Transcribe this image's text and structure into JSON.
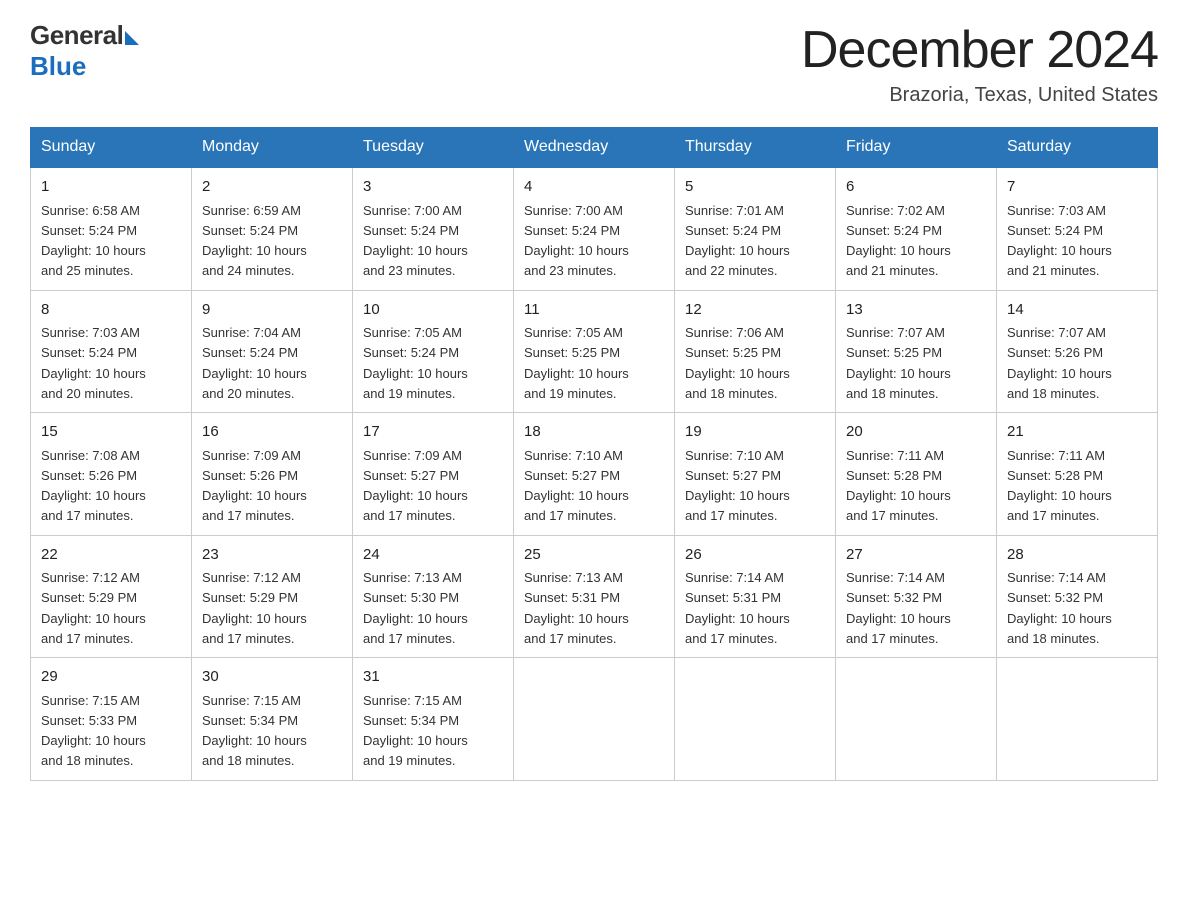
{
  "logo": {
    "general": "General",
    "blue": "Blue"
  },
  "header": {
    "title": "December 2024",
    "subtitle": "Brazoria, Texas, United States"
  },
  "days_of_week": [
    "Sunday",
    "Monday",
    "Tuesday",
    "Wednesday",
    "Thursday",
    "Friday",
    "Saturday"
  ],
  "weeks": [
    [
      {
        "day": "1",
        "sunrise": "6:58 AM",
        "sunset": "5:24 PM",
        "daylight": "10 hours and 25 minutes."
      },
      {
        "day": "2",
        "sunrise": "6:59 AM",
        "sunset": "5:24 PM",
        "daylight": "10 hours and 24 minutes."
      },
      {
        "day": "3",
        "sunrise": "7:00 AM",
        "sunset": "5:24 PM",
        "daylight": "10 hours and 23 minutes."
      },
      {
        "day": "4",
        "sunrise": "7:00 AM",
        "sunset": "5:24 PM",
        "daylight": "10 hours and 23 minutes."
      },
      {
        "day": "5",
        "sunrise": "7:01 AM",
        "sunset": "5:24 PM",
        "daylight": "10 hours and 22 minutes."
      },
      {
        "day": "6",
        "sunrise": "7:02 AM",
        "sunset": "5:24 PM",
        "daylight": "10 hours and 21 minutes."
      },
      {
        "day": "7",
        "sunrise": "7:03 AM",
        "sunset": "5:24 PM",
        "daylight": "10 hours and 21 minutes."
      }
    ],
    [
      {
        "day": "8",
        "sunrise": "7:03 AM",
        "sunset": "5:24 PM",
        "daylight": "10 hours and 20 minutes."
      },
      {
        "day": "9",
        "sunrise": "7:04 AM",
        "sunset": "5:24 PM",
        "daylight": "10 hours and 20 minutes."
      },
      {
        "day": "10",
        "sunrise": "7:05 AM",
        "sunset": "5:24 PM",
        "daylight": "10 hours and 19 minutes."
      },
      {
        "day": "11",
        "sunrise": "7:05 AM",
        "sunset": "5:25 PM",
        "daylight": "10 hours and 19 minutes."
      },
      {
        "day": "12",
        "sunrise": "7:06 AM",
        "sunset": "5:25 PM",
        "daylight": "10 hours and 18 minutes."
      },
      {
        "day": "13",
        "sunrise": "7:07 AM",
        "sunset": "5:25 PM",
        "daylight": "10 hours and 18 minutes."
      },
      {
        "day": "14",
        "sunrise": "7:07 AM",
        "sunset": "5:26 PM",
        "daylight": "10 hours and 18 minutes."
      }
    ],
    [
      {
        "day": "15",
        "sunrise": "7:08 AM",
        "sunset": "5:26 PM",
        "daylight": "10 hours and 17 minutes."
      },
      {
        "day": "16",
        "sunrise": "7:09 AM",
        "sunset": "5:26 PM",
        "daylight": "10 hours and 17 minutes."
      },
      {
        "day": "17",
        "sunrise": "7:09 AM",
        "sunset": "5:27 PM",
        "daylight": "10 hours and 17 minutes."
      },
      {
        "day": "18",
        "sunrise": "7:10 AM",
        "sunset": "5:27 PM",
        "daylight": "10 hours and 17 minutes."
      },
      {
        "day": "19",
        "sunrise": "7:10 AM",
        "sunset": "5:27 PM",
        "daylight": "10 hours and 17 minutes."
      },
      {
        "day": "20",
        "sunrise": "7:11 AM",
        "sunset": "5:28 PM",
        "daylight": "10 hours and 17 minutes."
      },
      {
        "day": "21",
        "sunrise": "7:11 AM",
        "sunset": "5:28 PM",
        "daylight": "10 hours and 17 minutes."
      }
    ],
    [
      {
        "day": "22",
        "sunrise": "7:12 AM",
        "sunset": "5:29 PM",
        "daylight": "10 hours and 17 minutes."
      },
      {
        "day": "23",
        "sunrise": "7:12 AM",
        "sunset": "5:29 PM",
        "daylight": "10 hours and 17 minutes."
      },
      {
        "day": "24",
        "sunrise": "7:13 AM",
        "sunset": "5:30 PM",
        "daylight": "10 hours and 17 minutes."
      },
      {
        "day": "25",
        "sunrise": "7:13 AM",
        "sunset": "5:31 PM",
        "daylight": "10 hours and 17 minutes."
      },
      {
        "day": "26",
        "sunrise": "7:14 AM",
        "sunset": "5:31 PM",
        "daylight": "10 hours and 17 minutes."
      },
      {
        "day": "27",
        "sunrise": "7:14 AM",
        "sunset": "5:32 PM",
        "daylight": "10 hours and 17 minutes."
      },
      {
        "day": "28",
        "sunrise": "7:14 AM",
        "sunset": "5:32 PM",
        "daylight": "10 hours and 18 minutes."
      }
    ],
    [
      {
        "day": "29",
        "sunrise": "7:15 AM",
        "sunset": "5:33 PM",
        "daylight": "10 hours and 18 minutes."
      },
      {
        "day": "30",
        "sunrise": "7:15 AM",
        "sunset": "5:34 PM",
        "daylight": "10 hours and 18 minutes."
      },
      {
        "day": "31",
        "sunrise": "7:15 AM",
        "sunset": "5:34 PM",
        "daylight": "10 hours and 19 minutes."
      },
      null,
      null,
      null,
      null
    ]
  ],
  "labels": {
    "sunrise": "Sunrise:",
    "sunset": "Sunset:",
    "daylight": "Daylight:"
  }
}
